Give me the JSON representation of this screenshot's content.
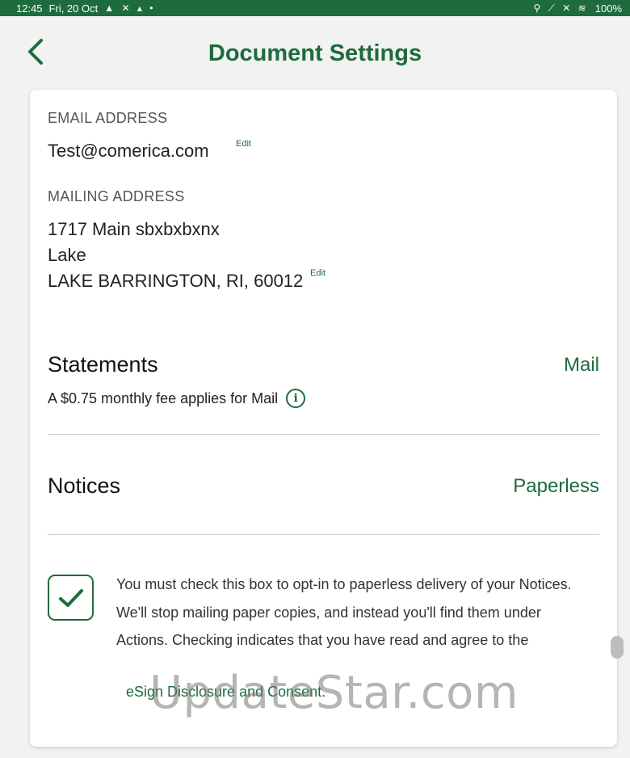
{
  "status_bar": {
    "time": "12:45",
    "date": "Fri, 20 Oct",
    "left_icons": "▲ ✕ ▴ •",
    "right_icons": "⚲ ⟋ ✕ ≋",
    "battery": "100%"
  },
  "header": {
    "title": "Document Settings",
    "back_icon": "chevron-left-icon"
  },
  "email": {
    "label": "EMAIL ADDRESS",
    "value": "Test@comerica.com",
    "edit_label": "Edit"
  },
  "mailing": {
    "label": "MAILING ADDRESS",
    "line1": "1717 Main  sbxbxbxnx",
    "line2": "Lake",
    "line3": "LAKE BARRINGTON, RI, 60012",
    "edit_label": "Edit"
  },
  "statements": {
    "title": "Statements",
    "value": "Mail",
    "note": "A $0.75 monthly fee applies for Mail",
    "info_icon": "info-icon"
  },
  "notices": {
    "title": "Notices",
    "value": "Paperless"
  },
  "consent": {
    "checked": true,
    "text": "You must check this box to opt-in to paperless delivery of your Notices. We'll stop mailing paper copies, and instead you'll find them under Actions. Checking indicates that you have read and agree to the",
    "link": "eSign Disclosure and Consent."
  },
  "watermark": "UpdateStar.com",
  "colors": {
    "brand_green": "#1e6b3e",
    "background": "#f2f2f2",
    "card": "#ffffff"
  }
}
